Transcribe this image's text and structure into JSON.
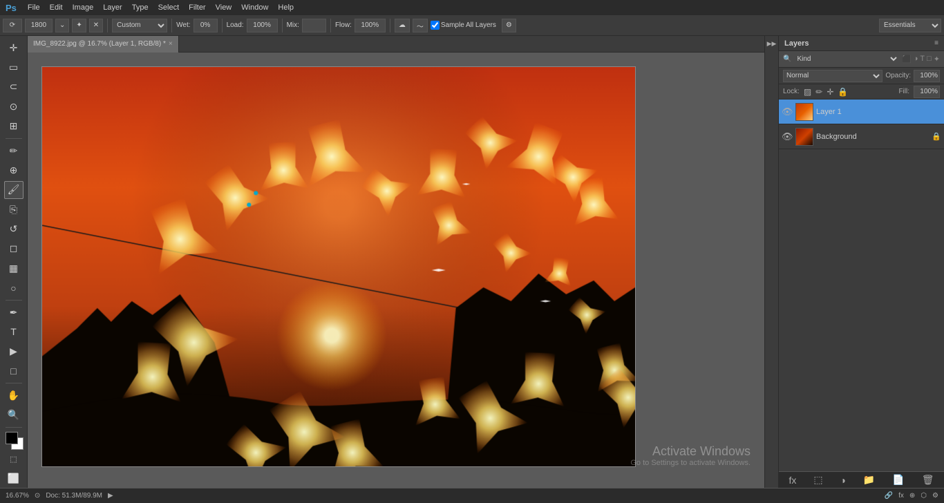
{
  "app": {
    "logo": "Ps",
    "menu_items": [
      "File",
      "Edit",
      "Image",
      "Layer",
      "Type",
      "Select",
      "Filter",
      "View",
      "Window",
      "Help"
    ]
  },
  "toolbar": {
    "brush_size": "1800",
    "mode_label": "Custom",
    "wet_label": "Wet:",
    "wet_value": "0%",
    "load_label": "Load:",
    "load_value": "100%",
    "mix_label": "Mix:",
    "flow_label": "Flow:",
    "flow_value": "100%",
    "sample_all_label": "Sample All Layers",
    "essentials_label": "Essentials"
  },
  "tab": {
    "title": "IMG_8922.jpg @ 16.7% (Layer 1, RGB/8) *",
    "close": "×"
  },
  "status_bar": {
    "zoom": "16.67%",
    "doc_size": "Doc: 51.3M/89.9M"
  },
  "layers_panel": {
    "title": "Layers",
    "kind_label": "Kind",
    "blend_mode": "Normal",
    "opacity_label": "Opacity:",
    "opacity_value": "100%",
    "lock_label": "Lock:",
    "fill_label": "Fill:",
    "fill_value": "100%",
    "layers": [
      {
        "name": "Layer 1",
        "visible": true,
        "selected": true,
        "locked": false
      },
      {
        "name": "Background",
        "visible": true,
        "selected": false,
        "locked": true
      }
    ]
  },
  "activate_windows": {
    "title": "Activate Windows",
    "subtitle": "Go to Settings to activate Windows."
  }
}
